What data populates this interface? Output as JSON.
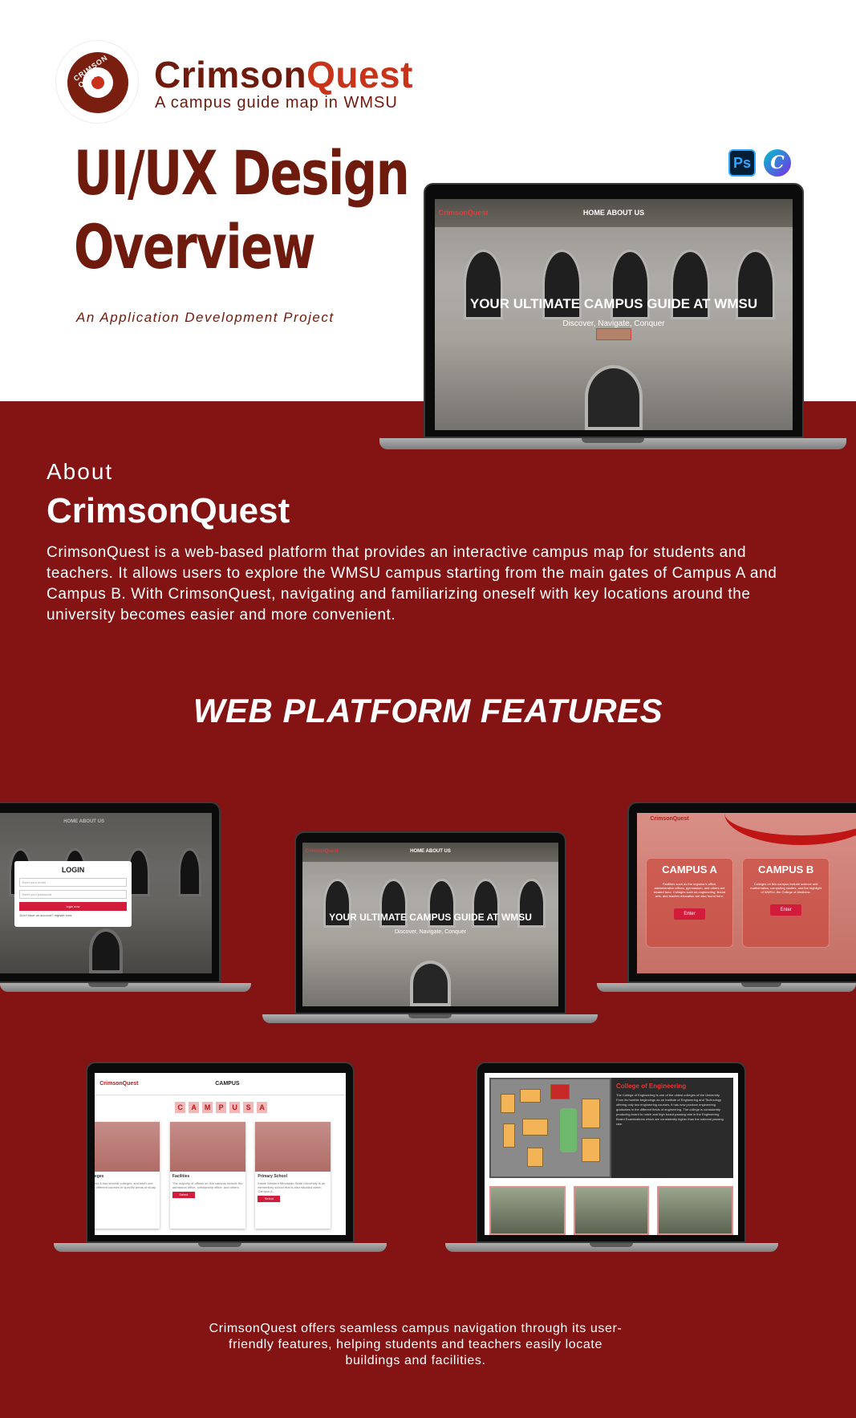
{
  "header": {
    "logo_text": "CRIMSON QUEST",
    "brand_main": "Crimson",
    "brand_accent": "Quest",
    "tagline": "A campus guide map in WMSU",
    "title": "UI/UX Design Overview",
    "subtitle": "An Application Development Project",
    "tools": [
      "Ps",
      "C"
    ]
  },
  "about": {
    "label": "About",
    "name": "CrimsonQuest",
    "description": "CrimsonQuest is a web-based platform that provides an interactive campus map for students and teachers. It allows users to explore the WMSU campus starting from the main gates of Campus A and Campus B. With CrimsonQuest, navigating and familiarizing oneself with key locations around the university becomes easier and more convenient."
  },
  "features_title": "WEB PLATFORM FEATURES",
  "mockups": {
    "hero": {
      "nav_brand": "CrimsonQuest",
      "nav_links": "HOME    ABOUT US",
      "heading": "YOUR ULTIMATE CAMPUS GUIDE AT WMSU",
      "subheading": "Discover, Navigate, Conquer"
    },
    "login": {
      "nav_links": "HOME    ABOUT US",
      "title": "LOGIN",
      "email_placeholder": "Enter your email",
      "password_placeholder": "Enter your password",
      "submit": "login now",
      "register": "Don't have an account? register now"
    },
    "campus_select": {
      "brand": "CrimsonQuest",
      "campus_a": "CAMPUS A",
      "campus_b": "CAMPUS B",
      "campus_a_desc": "Facilities such as the registrar's office, administrative offices, gymnasium, and others are located here. Colleges such as engineering, liberal arts, and teacher education are also found here.",
      "campus_b_desc": "Colleges on this campus include science and mathematics, computing studies, and the highlight of WMSU, the College of Medicine.",
      "enter": "Enter"
    },
    "campus_list": {
      "brand": "CrimsonQuest",
      "nav": "CAMPUS",
      "letters": [
        "C",
        "A",
        "M",
        "P",
        "U",
        "S",
        "A"
      ],
      "cards": [
        {
          "name": "Colleges",
          "desc": "Campus A has several colleges, and each one offers different courses in specific areas of study."
        },
        {
          "name": "Facilities",
          "desc": "The majority of offices on this campus include the admission office, scholarship office, and others."
        },
        {
          "name": "Primary School",
          "desc": "Inside Western Mindanao State University is an elementary school that is also situated within Campus A."
        }
      ],
      "select": "Select"
    },
    "map_view": {
      "college_title": "College of Engineering",
      "college_desc": "The College of Engineering is one of the oldest colleges of the University. From its humble beginnings as an Institute of Engineering and Technology offering only two engineering courses, it has now produce engineering graduates in the different fields of engineering. The college is consistently producing board to notch and high board passing rate in the Engineering Board Examinations which are consistently higher than the national passing rate."
    }
  },
  "footer": "CrimsonQuest offers seamless campus navigation through its user-friendly features, helping students and teachers easily locate buildings and facilities.",
  "colors": {
    "maroon": "#841313",
    "title_brown": "#6e1a0c",
    "accent": "#c7341a",
    "button_red": "#d11c3b"
  }
}
